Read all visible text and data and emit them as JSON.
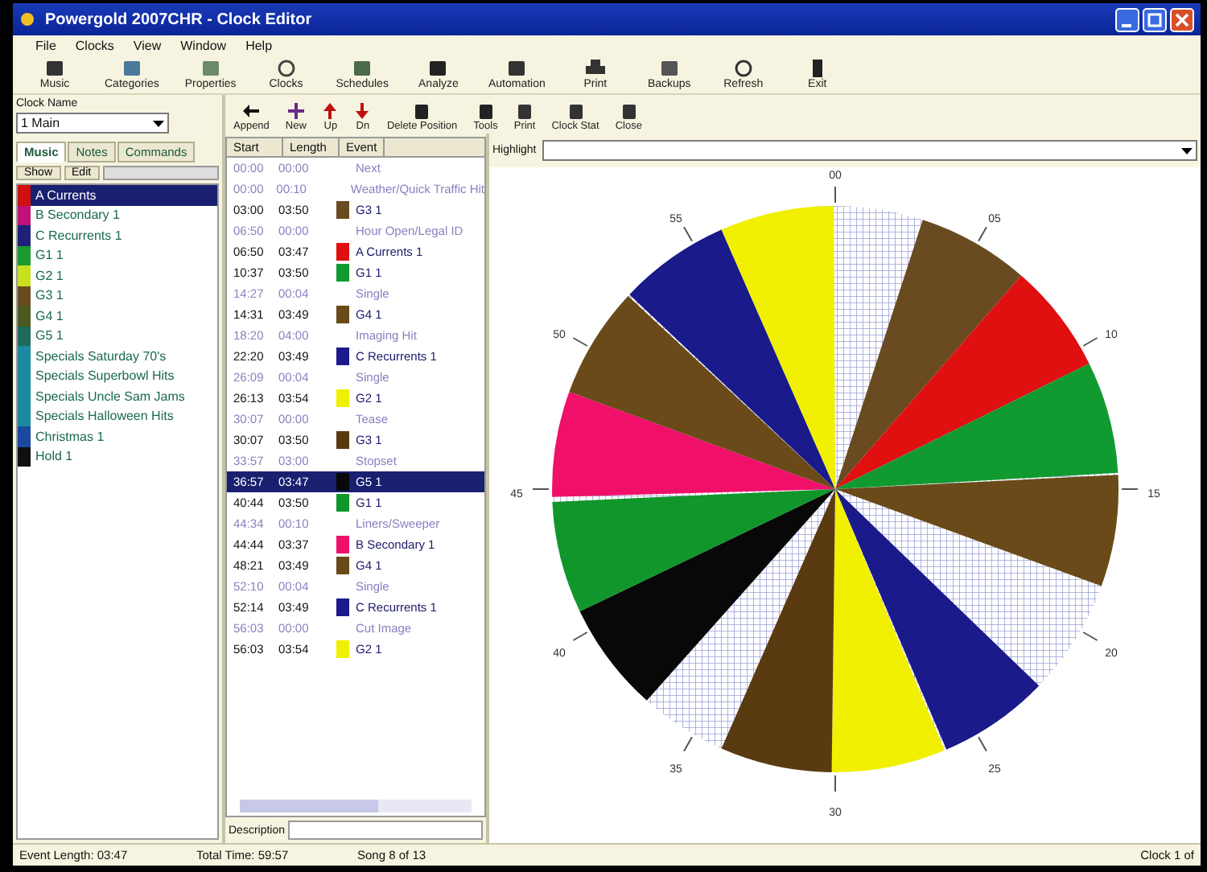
{
  "window": {
    "title": "Powergold 2007CHR - Clock Editor"
  },
  "menu": [
    "File",
    "Clocks",
    "View",
    "Window",
    "Help"
  ],
  "toolbar": [
    "Music",
    "Categories",
    "Properties",
    "Clocks",
    "Schedules",
    "Analyze",
    "Automation",
    "Print",
    "Backups",
    "Refresh",
    "Exit"
  ],
  "clock_name": {
    "label": "Clock Name",
    "value": "1 Main"
  },
  "toolbar2": [
    "Append",
    "New",
    "Up",
    "Dn",
    "Delete Position",
    "Tools",
    "Print",
    "Clock Stat",
    "Close"
  ],
  "tabs": [
    {
      "label": "Music",
      "selected": true
    },
    {
      "label": "Notes",
      "selected": false
    },
    {
      "label": "Commands",
      "selected": false
    }
  ],
  "list_buttons": [
    "Show",
    "Edit"
  ],
  "categories": [
    {
      "name": "A Currents",
      "color": "#d01010",
      "selected": true
    },
    {
      "name": "B Secondary 1",
      "color": "#c0107a",
      "selected": false
    },
    {
      "name": "C Recurrents 1",
      "color": "#20207a",
      "selected": false
    },
    {
      "name": "G1  1",
      "color": "#1a9a30",
      "selected": false
    },
    {
      "name": "G2  1",
      "color": "#c8e020",
      "selected": false
    },
    {
      "name": "G3  1",
      "color": "#6a4a20",
      "selected": false
    },
    {
      "name": "G4  1",
      "color": "#4a5a20",
      "selected": false
    },
    {
      "name": "G5  1",
      "color": "#206a5a",
      "selected": false
    },
    {
      "name": "Specials  Saturday 70's",
      "color": "#1a8aa0",
      "selected": false
    },
    {
      "name": "Specials  Superbowl Hits",
      "color": "#1a8aa0",
      "selected": false
    },
    {
      "name": "Specials  Uncle Sam Jams",
      "color": "#1a8aa0",
      "selected": false
    },
    {
      "name": "Specials  Halloween Hits",
      "color": "#1a8aa0",
      "selected": false
    },
    {
      "name": "Christmas  1",
      "color": "#1a4aa0",
      "selected": false
    },
    {
      "name": "Hold  1",
      "color": "#101010",
      "selected": false
    }
  ],
  "grid": {
    "columns": [
      "Start",
      "Length",
      "Event"
    ]
  },
  "events": [
    {
      "kind": "other",
      "start": "00:00",
      "length": "00:00",
      "event": "Next",
      "selected": false
    },
    {
      "kind": "other",
      "start": "00:00",
      "length": "00:10",
      "event": "Weather/Quick Traffic Hit",
      "selected": false
    },
    {
      "kind": "song",
      "start": "03:00",
      "length": "03:50",
      "event": "G3  1",
      "color": "#6a4a20",
      "selected": false
    },
    {
      "kind": "other",
      "start": "06:50",
      "length": "00:00",
      "event": "Hour Open/Legal ID",
      "selected": false
    },
    {
      "kind": "song",
      "start": "06:50",
      "length": "03:47",
      "event": "A Currents  1",
      "color": "#e01010",
      "selected": false
    },
    {
      "kind": "song",
      "start": "10:37",
      "length": "03:50",
      "event": "G1  1",
      "color": "#109a30",
      "selected": false
    },
    {
      "kind": "other",
      "start": "14:27",
      "length": "00:04",
      "event": "Single",
      "selected": false
    },
    {
      "kind": "song",
      "start": "14:31",
      "length": "03:49",
      "event": "G4  1",
      "color": "#6a4a18",
      "selected": false
    },
    {
      "kind": "other",
      "start": "18:20",
      "length": "04:00",
      "event": "Imaging Hit",
      "selected": false
    },
    {
      "kind": "song",
      "start": "22:20",
      "length": "03:49",
      "event": "C Recurrents  1",
      "color": "#1a1a8a",
      "selected": false
    },
    {
      "kind": "other",
      "start": "26:09",
      "length": "00:04",
      "event": "Single",
      "selected": false
    },
    {
      "kind": "song",
      "start": "26:13",
      "length": "03:54",
      "event": "G2  1",
      "color": "#f0f000",
      "selected": false
    },
    {
      "kind": "other",
      "start": "30:07",
      "length": "00:00",
      "event": "Tease",
      "selected": false
    },
    {
      "kind": "song",
      "start": "30:07",
      "length": "03:50",
      "event": "G3  1",
      "color": "#5a3a10",
      "selected": false
    },
    {
      "kind": "other",
      "start": "33:57",
      "length": "03:00",
      "event": "Stopset",
      "selected": false
    },
    {
      "kind": "song",
      "start": "36:57",
      "length": "03:47",
      "event": "G5  1",
      "color": "#080808",
      "selected": true
    },
    {
      "kind": "song",
      "start": "40:44",
      "length": "03:50",
      "event": "G1  1",
      "color": "#10962a",
      "selected": false
    },
    {
      "kind": "other",
      "start": "44:34",
      "length": "00:10",
      "event": "Liners/Sweeper",
      "selected": false
    },
    {
      "kind": "song",
      "start": "44:44",
      "length": "03:37",
      "event": "B Secondary  1",
      "color": "#f0106a",
      "selected": false
    },
    {
      "kind": "song",
      "start": "48:21",
      "length": "03:49",
      "event": "G4  1",
      "color": "#6a4a18",
      "selected": false
    },
    {
      "kind": "other",
      "start": "52:10",
      "length": "00:04",
      "event": "Single",
      "selected": false
    },
    {
      "kind": "song",
      "start": "52:14",
      "length": "03:49",
      "event": "C Recurrents  1",
      "color": "#1a1a8a",
      "selected": false
    },
    {
      "kind": "other",
      "start": "56:03",
      "length": "00:00",
      "event": "Cut Image",
      "selected": false
    },
    {
      "kind": "song",
      "start": "56:03",
      "length": "03:54",
      "event": "G2  1",
      "color": "#f0f000",
      "selected": false
    }
  ],
  "description": {
    "label": "Description"
  },
  "highlight": {
    "label": "Highlight"
  },
  "minute_labels": [
    "00",
    "05",
    "10",
    "15",
    "20",
    "25",
    "30",
    "35",
    "40",
    "45",
    "50",
    "55"
  ],
  "status_bar": [
    "Event Length: 03:47",
    "Total Time: 59:57",
    "Song 8 of 13",
    "Clock 1 of"
  ]
}
